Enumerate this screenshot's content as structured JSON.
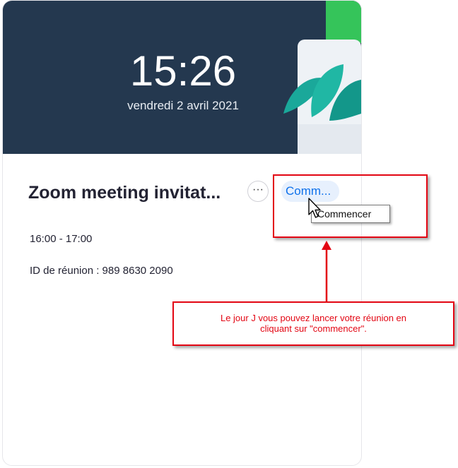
{
  "clock": {
    "time": "15:26",
    "date": "vendredi 2 avril 2021"
  },
  "meeting": {
    "title": "Zoom meeting invitat...",
    "more_label": "···",
    "start_label": "Comm...",
    "time_range": "16:00 - 17:00",
    "meeting_id": "ID de réunion : 989 8630 2090"
  },
  "tooltip": "Commencer",
  "annotation": {
    "line1": "Le jour J vous pouvez lancer votre réunion en",
    "line2": "cliquant sur \"commencer\"."
  },
  "colors": {
    "banner": "#24384f",
    "accent": "#0e71eb",
    "annotation_red": "#e30613"
  },
  "icons": {
    "more": "ellipsis-icon",
    "cursor": "mouse-cursor-icon",
    "arrow": "arrow-up-icon"
  }
}
